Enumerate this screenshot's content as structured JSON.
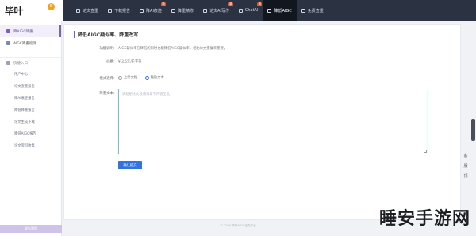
{
  "logo": {
    "text": "毕叶",
    "badge": "5"
  },
  "nav": [
    {
      "label": "论文查重",
      "badge": ""
    },
    {
      "label": "下载报告",
      "badge": ""
    },
    {
      "label": "降AI痕迹",
      "badge": "新"
    },
    {
      "label": "降重精修",
      "badge": ""
    },
    {
      "label": "论文AI写作",
      "badge": "新"
    },
    {
      "label": "ChatAI",
      "badge": "新"
    },
    {
      "label": "降低AIGC",
      "badge": ""
    },
    {
      "label": "免费查重",
      "badge": ""
    }
  ],
  "nav_active_index": 6,
  "sidebar": {
    "items": [
      {
        "label": "降AIGC降重",
        "active": true
      },
      {
        "label": "AIGC降重检测",
        "active": false
      }
    ],
    "group": "快捷入口",
    "links": [
      "用户中心",
      "论文查重报告",
      "降AI痕迹报告",
      "降低降重报告",
      "论文生成下载",
      "降低AIGC报告",
      "论文资料收集"
    ],
    "bottom": "联系客服"
  },
  "card": {
    "title": "降低AIGC疑似率、降重改写",
    "desc_label": "功能说明：",
    "desc_text": "AIGC疑似率在降低的同时也能降低AIGC疑似率，相比论文重复率重要。",
    "price_label": "价格：",
    "price_text": "¥ 3.5元/千字符",
    "mode_label": "模式选择：",
    "modes": [
      {
        "label": "上传文档",
        "selected": false
      },
      {
        "label": "粘贴文本",
        "selected": true
      }
    ],
    "content_label": "降重文本：",
    "placeholder": "请粘贴论文段落或章节内容至此",
    "submit_label": "确认提交"
  },
  "footer": "© 2024 毕叶AIGC论文平台",
  "float_tools": [
    "客",
    "服",
    "顶"
  ],
  "watermark": "睡安手游网"
}
